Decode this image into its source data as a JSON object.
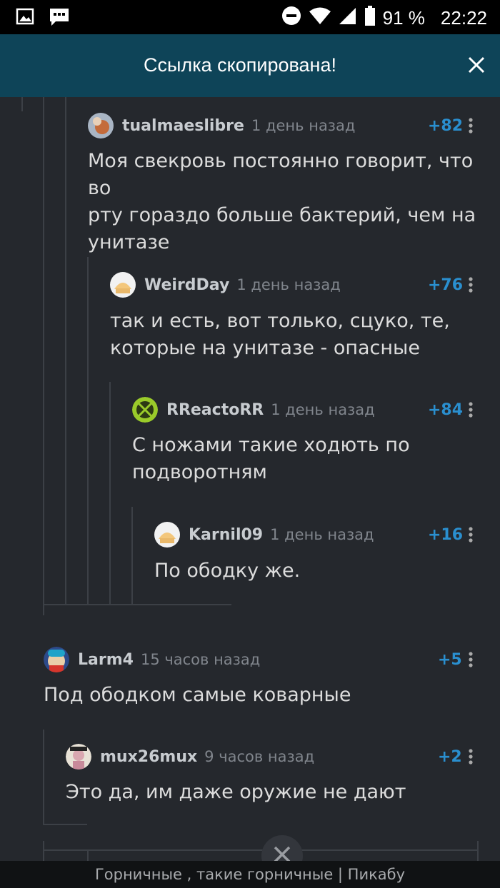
{
  "status_bar": {
    "battery": "91 %",
    "time": "22:22",
    "icons": [
      "image-icon",
      "chat-icon",
      "dnd-icon",
      "wifi-icon",
      "signal-icon",
      "battery-icon"
    ]
  },
  "toast": {
    "text": "Ссылка скопирована!",
    "close_icon": "close-icon"
  },
  "comments": [
    {
      "id": "c1",
      "user": "tualmaeslibre",
      "time": "1 день назад",
      "rating": "+82",
      "lines": [
        "Моя свекровь постоянно говорит, что во",
        "рту гораздо больше бактерий, чем на",
        "унитазе"
      ]
    },
    {
      "id": "c2",
      "user": "WeirdDay",
      "time": "1 день назад",
      "rating": "+76",
      "lines": [
        "так и есть, вот только, сцуко, те,",
        "которые на унитазе - опасные"
      ]
    },
    {
      "id": "c3",
      "user": "RReactoRR",
      "time": "1 день назад",
      "rating": "+84",
      "lines": [
        "С ножами такие ходють по",
        "подворотням"
      ]
    },
    {
      "id": "c4",
      "user": "Karnil09",
      "time": "1 день назад",
      "rating": "+16",
      "lines": [
        "По ободку же."
      ]
    },
    {
      "id": "c5",
      "user": "Larm4",
      "time": "15 часов назад",
      "rating": "+5",
      "lines": [
        "Под ободком самые коварные"
      ]
    },
    {
      "id": "c6",
      "user": "mux26mux",
      "time": "9 часов назад",
      "rating": "+2",
      "lines": [
        "Это да, им даже оружие не дают"
      ]
    }
  ],
  "footer": {
    "title": "Горничные , такие горничные | Пикабу"
  },
  "colors": {
    "background": "#25282d",
    "toast": "#0e4458",
    "rating": "#2a8fcf",
    "thread_line": "#3c4046"
  }
}
